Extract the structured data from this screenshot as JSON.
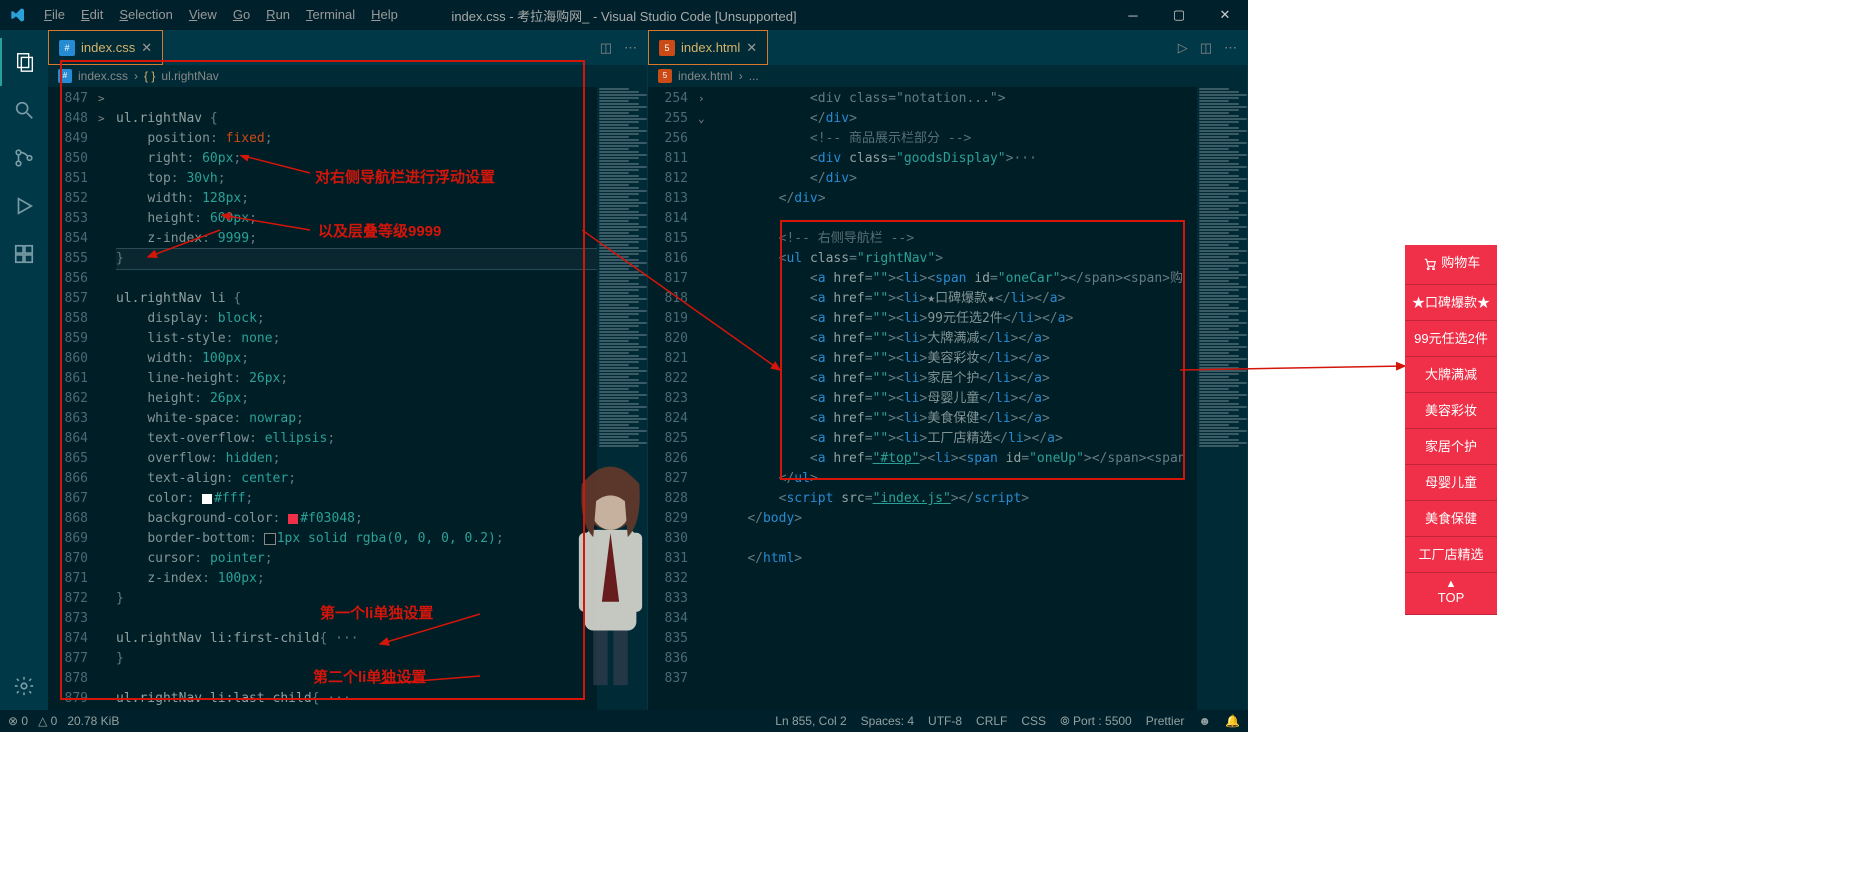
{
  "title": "index.css - 考拉海购网_ - Visual Studio Code [Unsupported]",
  "menu": [
    "File",
    "Edit",
    "Selection",
    "View",
    "Go",
    "Run",
    "Terminal",
    "Help"
  ],
  "tabs_left": {
    "label": "index.css",
    "close": "✕"
  },
  "tabs_right": {
    "label": "index.html",
    "close": "✕"
  },
  "breadcrumb_left": {
    "icon": "🗎",
    "file": "index.css",
    "sep": "›",
    "sym": "{ }",
    "rule": "ul.rightNav"
  },
  "breadcrumb_right": {
    "icon": "🗎",
    "file": "index.html",
    "sep": "›",
    "dots": "..."
  },
  "left_lines": [
    {
      "n": 847,
      "t": ""
    },
    {
      "n": 848,
      "t": "ul.rightNav {",
      "s": "sel-open"
    },
    {
      "n": 849,
      "t": "    position: fixed;",
      "p": "position",
      "v": "fixed",
      "fixed": true
    },
    {
      "n": 850,
      "t": "    right: 60px;",
      "p": "right",
      "v": "60px"
    },
    {
      "n": 851,
      "t": "    top: 30vh;",
      "p": "top",
      "v": "30vh"
    },
    {
      "n": 852,
      "t": "    width: 128px;",
      "p": "width",
      "v": "128px"
    },
    {
      "n": 853,
      "t": "    height: 600px;",
      "p": "height",
      "v": "600px"
    },
    {
      "n": 854,
      "t": "    z-index: 9999;",
      "p": "z-index",
      "v": "9999"
    },
    {
      "n": 855,
      "t": "}",
      "close": true,
      "current": true
    },
    {
      "n": 856,
      "t": ""
    },
    {
      "n": 857,
      "t": "ul.rightNav li {",
      "s": "sel-open",
      "sel": "ul.rightNav li"
    },
    {
      "n": 858,
      "t": "    display: block;",
      "p": "display",
      "v": "block"
    },
    {
      "n": 859,
      "t": "    list-style: none;",
      "p": "list-style",
      "v": "none"
    },
    {
      "n": 860,
      "t": "    width: 100px;",
      "p": "width",
      "v": "100px"
    },
    {
      "n": 861,
      "t": "    line-height: 26px;",
      "p": "line-height",
      "v": "26px"
    },
    {
      "n": 862,
      "t": "    height: 26px;",
      "p": "height",
      "v": "26px"
    },
    {
      "n": 863,
      "t": "    white-space: nowrap;",
      "p": "white-space",
      "v": "nowrap"
    },
    {
      "n": 864,
      "t": "    text-overflow: ellipsis;",
      "p": "text-overflow",
      "v": "ellipsis"
    },
    {
      "n": 865,
      "t": "    overflow: hidden;",
      "p": "overflow",
      "v": "hidden"
    },
    {
      "n": 866,
      "t": "    text-align: center;",
      "p": "text-align",
      "v": "center"
    },
    {
      "n": 867,
      "t": "    color: #fff;",
      "p": "color",
      "v": "#fff",
      "cb": "#fff"
    },
    {
      "n": 868,
      "t": "    background-color: #f03048;",
      "p": "background-color",
      "v": "#f03048",
      "cb": "#f03048"
    },
    {
      "n": 869,
      "t": "    border-bottom: 1px solid rgba(0, 0, 0, 0.2);",
      "p": "border-bottom",
      "v": "1px solid rgba(0, 0, 0, 0.2)",
      "cb": "rgba(0,0,0,0.2)",
      "cbOutline": true
    },
    {
      "n": 870,
      "t": "    cursor: pointer;",
      "p": "cursor",
      "v": "pointer"
    },
    {
      "n": 871,
      "t": "    z-index: 100px;",
      "p": "z-index",
      "v": "100px"
    },
    {
      "n": 872,
      "t": "}",
      "close": true
    },
    {
      "n": 873,
      "t": ""
    },
    {
      "n": 874,
      "t": "ul.rightNav li:first-child{ ···",
      "fold": ">",
      "sel": "ul.rightNav li:first-child"
    },
    {
      "n": 877,
      "t": "}",
      "close": true
    },
    {
      "n": 878,
      "t": ""
    },
    {
      "n": 879,
      "t": "ul.rightNav li:last-child{ ···",
      "fold": ">",
      "sel": "ul.rightNav li:last-child"
    }
  ],
  "right_lines": [
    {
      "n": "",
      "ind": 3,
      "raw": "<div class=\"notation...\">"
    },
    {
      "n": 254,
      "ind": 3,
      "close": "div"
    },
    {
      "n": 255,
      "ind": 3,
      "cmt": "<!-- 商品展示栏部分 -->"
    },
    {
      "n": 256,
      "fold": ">",
      "ind": 3,
      "open": "div",
      "attrs": "class=\"goodsDisplay\"",
      "trail": "···"
    },
    {
      "n": 811,
      "ind": 3,
      "close": "div"
    },
    {
      "n": 812,
      "ind": 2,
      "close": "div"
    },
    {
      "n": 813,
      "ind": 0,
      "blank": true
    },
    {
      "n": 814,
      "ind": 2,
      "cmt": "<!-- 右侧导航栏 -->"
    },
    {
      "n": 815,
      "fold": "v",
      "ind": 2,
      "open": "ul",
      "attrs": "class=\"rightNav\""
    },
    {
      "n": 816,
      "ind": 3,
      "a": "",
      "li": true,
      "spanid": "oneCar",
      "after": "</span><span>购"
    },
    {
      "n": 817,
      "ind": 3,
      "a": "",
      "litext": "★口碑爆款★"
    },
    {
      "n": 818,
      "ind": 3,
      "a": "",
      "litext": "99元任选2件"
    },
    {
      "n": 819,
      "ind": 3,
      "a": "",
      "litext": "大牌满减"
    },
    {
      "n": 820,
      "ind": 3,
      "a": "",
      "litext": "美容彩妆"
    },
    {
      "n": 821,
      "ind": 3,
      "a": "",
      "litext": "家居个护"
    },
    {
      "n": 822,
      "ind": 3,
      "a": "",
      "litext": "母婴儿童"
    },
    {
      "n": 823,
      "ind": 3,
      "a": "",
      "litext": "美食保健"
    },
    {
      "n": 824,
      "ind": 3,
      "a": "",
      "litext": "工厂店精选"
    },
    {
      "n": 825,
      "ind": 3,
      "a": "#top",
      "li": true,
      "spanid": "oneUp",
      "after": "</span><span"
    },
    {
      "n": 826,
      "ind": 2,
      "close": "ul"
    },
    {
      "n": 827,
      "ind": 2,
      "script": "index.js"
    },
    {
      "n": 828,
      "ind": 1,
      "close": "body"
    },
    {
      "n": 829,
      "blank": true
    },
    {
      "n": 830,
      "ind": 1,
      "close": "html"
    },
    {
      "n": 831,
      "blank": true
    },
    {
      "n": 832,
      "blank": true
    },
    {
      "n": 833,
      "blank": true
    },
    {
      "n": 834,
      "blank": true
    },
    {
      "n": 835,
      "blank": true
    },
    {
      "n": 836,
      "blank": true
    },
    {
      "n": 837,
      "blank": true
    }
  ],
  "annotations": {
    "a1": "对右侧导航栏进行浮动设置",
    "a2": "以及层叠等级9999",
    "a3": "第一个li单独设置",
    "a4": "第二个li单独设置"
  },
  "rightnav_items": [
    "🛒 购物车",
    "★口碑爆款★",
    "99元任选2件",
    "大牌满减",
    "美容彩妆",
    "家居个护",
    "母婴儿童",
    "美食保健",
    "工厂店精选"
  ],
  "rightnav_top": {
    "up": "▲",
    "label": "TOP"
  },
  "status": {
    "errors": "⊗ 0",
    "warnings": "△ 0",
    "size": "20.78 KiB",
    "pos": "Ln 855, Col 2",
    "spaces": "Spaces: 4",
    "enc": "UTF-8",
    "eol": "CRLF",
    "lang": "CSS",
    "port": "⦾ Port : 5500",
    "prettier": "Prettier",
    "feedback": "☻",
    "bell": "🔔"
  }
}
